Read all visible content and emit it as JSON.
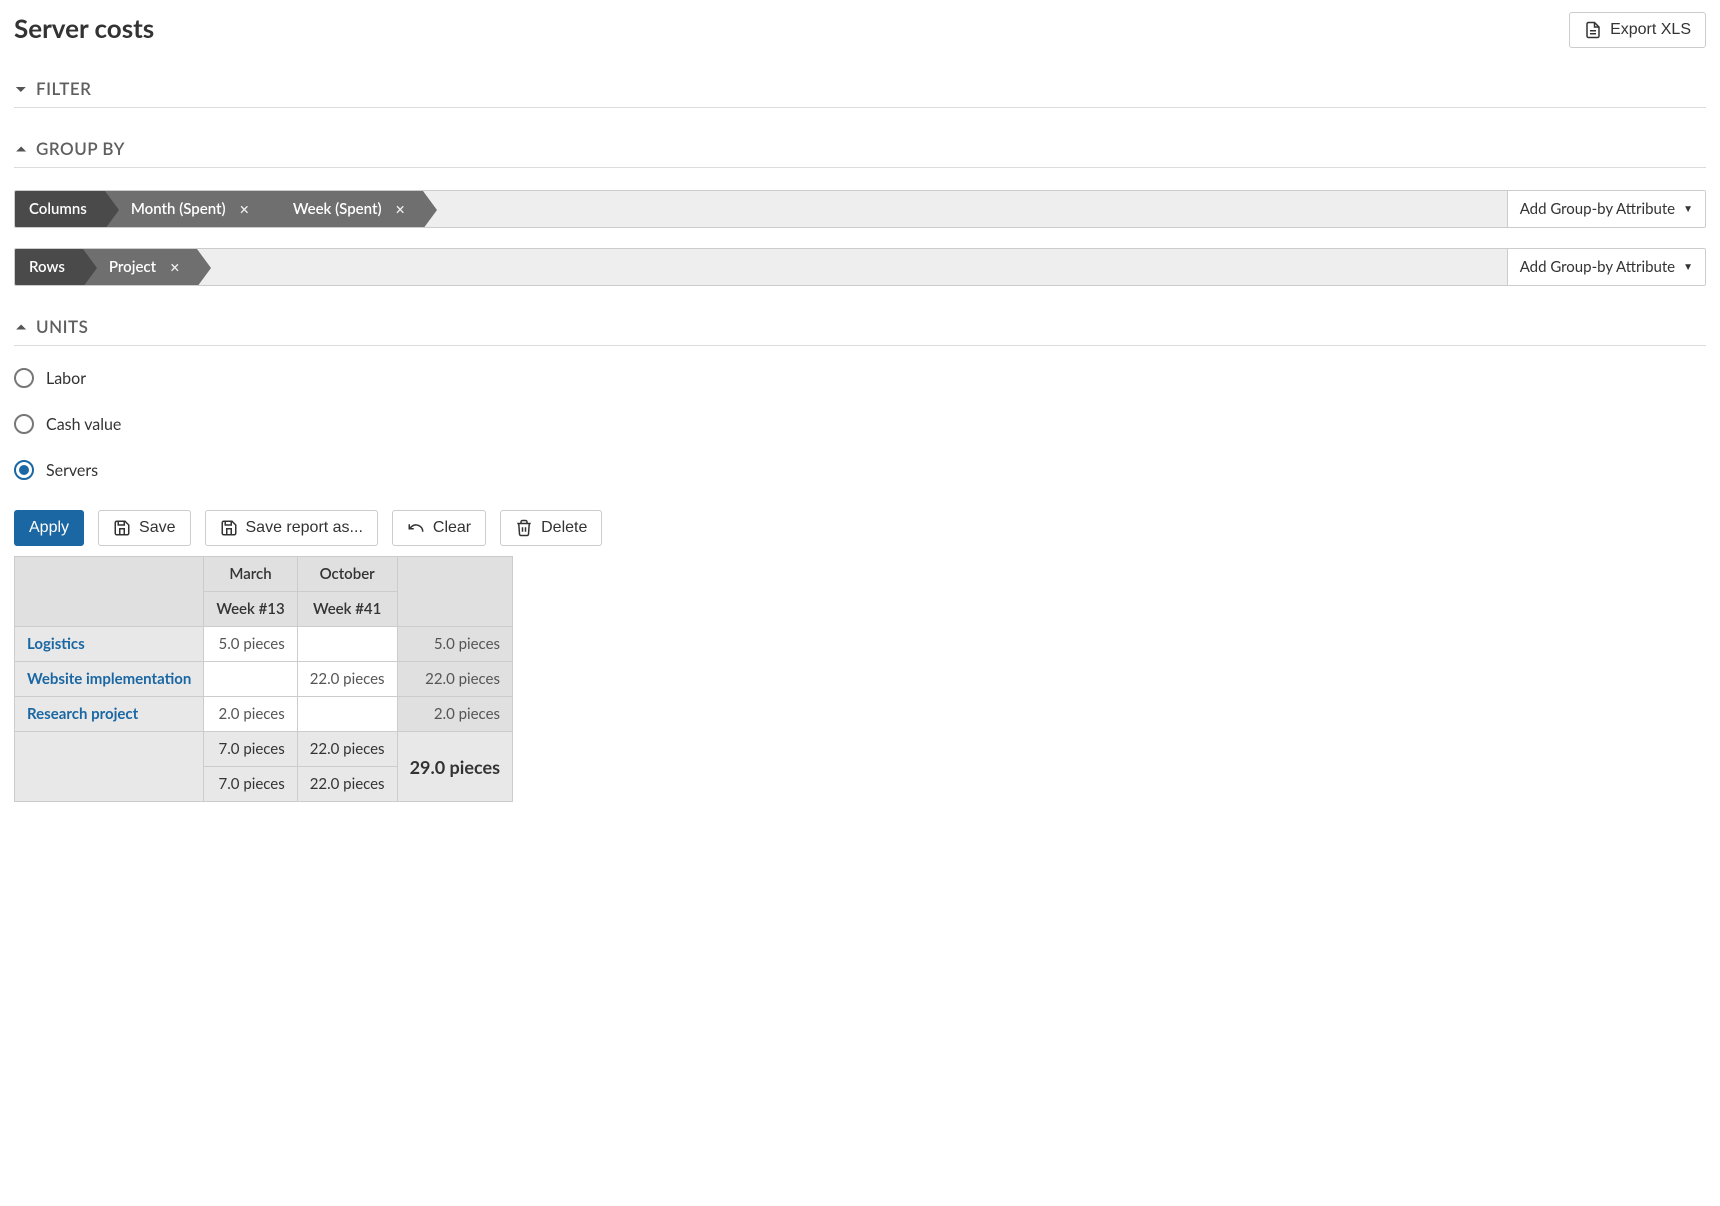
{
  "page_title": "Server costs",
  "export_button": "Export XLS",
  "sections": {
    "filter": {
      "label": "FILTER",
      "collapsed": true
    },
    "groupby": {
      "label": "GROUP BY",
      "columns_label": "Columns",
      "rows_label": "Rows",
      "columns": [
        {
          "label": "Month (Spent)"
        },
        {
          "label": "Week (Spent)"
        }
      ],
      "rows": [
        {
          "label": "Project"
        }
      ],
      "add_label": "Add Group-by Attribute"
    },
    "units": {
      "label": "UNITS",
      "options": [
        {
          "label": "Labor",
          "checked": false
        },
        {
          "label": "Cash value",
          "checked": false
        },
        {
          "label": "Servers",
          "checked": true
        }
      ]
    }
  },
  "actions": {
    "apply": "Apply",
    "save": "Save",
    "saveas": "Save report as...",
    "clear": "Clear",
    "delete": "Delete"
  },
  "table": {
    "months": [
      "March",
      "October"
    ],
    "weeks": [
      "Week #13",
      "Week #41"
    ],
    "rows": [
      {
        "name": "Logistics",
        "cells": [
          "5.0 pieces",
          ""
        ],
        "total": "5.0 pieces"
      },
      {
        "name": "Website implementation",
        "cells": [
          "",
          "22.0 pieces"
        ],
        "total": "22.0 pieces"
      },
      {
        "name": "Research project",
        "cells": [
          "2.0 pieces",
          ""
        ],
        "total": "2.0 pieces"
      }
    ],
    "col_totals_1": [
      "7.0 pieces",
      "22.0 pieces"
    ],
    "col_totals_2": [
      "7.0 pieces",
      "22.0 pieces"
    ],
    "grand_total": "29.0 pieces"
  }
}
